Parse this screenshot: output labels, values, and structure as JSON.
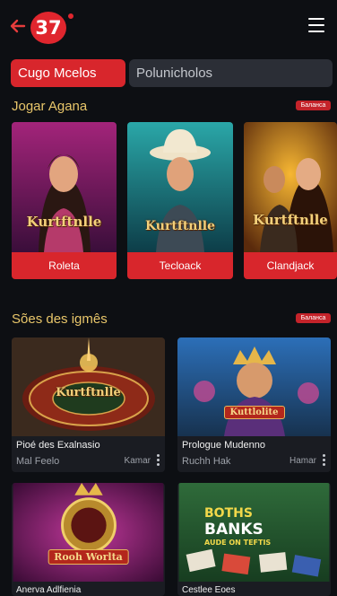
{
  "header": {
    "logo_text": "37",
    "back_icon": "arrow-left-icon",
    "menu_icon": "hamburger-menu-icon"
  },
  "tabs": [
    {
      "label": "Cugo Mcelos",
      "active": true
    },
    {
      "label": "Polunicholos",
      "active": false
    }
  ],
  "section1": {
    "title": "Jogar Agana",
    "badge": "Баланса",
    "cards": [
      {
        "art_text": "Kurtftnlle",
        "button": "Roleta"
      },
      {
        "art_text": "Kurtftnlle",
        "button": "Tecloack"
      },
      {
        "art_text": "Kurtftnlle",
        "button": "Clandjack"
      }
    ]
  },
  "section2": {
    "title": "Sões des igmês",
    "badge": "Баланса",
    "tiles": [
      {
        "art_text": "Kurtftnlle",
        "title": "Pioé des Exalnasio",
        "subtitle": "Mal Feelo",
        "meta": "Kamar"
      },
      {
        "art_text": "Kuttlolite",
        "title": "Prologue Mudenno",
        "subtitle": "Ruchh Hak",
        "meta": "Hamar"
      },
      {
        "art_text": "Rooh Worlta",
        "title": "Anerva Adlfienia",
        "subtitle": "",
        "meta": ""
      },
      {
        "art_text_1": "BOTHS",
        "art_text_2": "BANKS",
        "art_text_3": "AUDE ON TEFTIS",
        "title": "Cestlee Eoes",
        "subtitle": "",
        "meta": ""
      }
    ]
  },
  "colors": {
    "accent": "#d8262c",
    "gold": "#e8c66a",
    "background": "#0d0f13"
  }
}
